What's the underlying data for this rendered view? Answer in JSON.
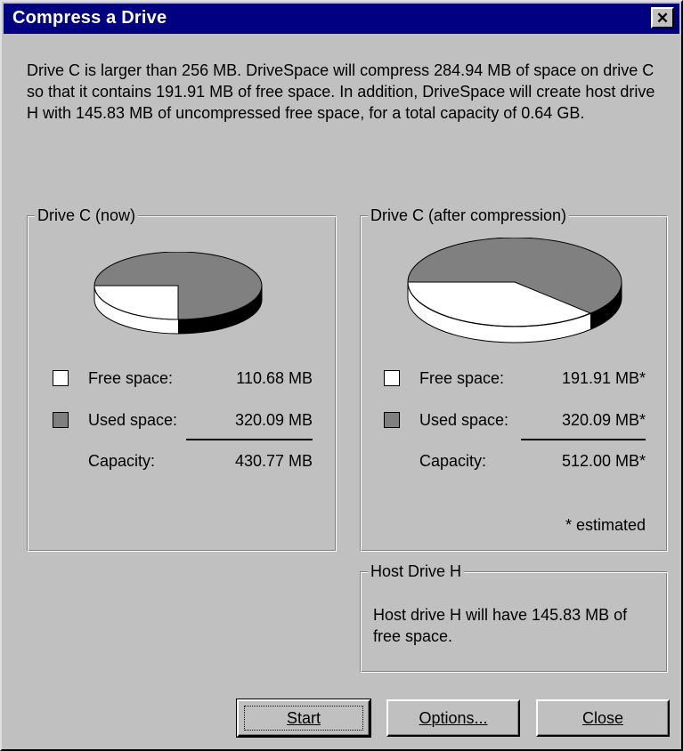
{
  "window": {
    "title": "Compress a Drive",
    "close_glyph": "✕"
  },
  "intro": "Drive C is larger than 256 MB. DriveSpace will compress 284.94 MB of space on drive C so that it contains 191.91 MB of free space. In addition, DriveSpace will create host drive H with 145.83 MB of uncompressed free space, for a total capacity of 0.64 GB.",
  "now": {
    "title": "Drive C (now)",
    "free_label": "Free space:",
    "free_value": "110.68 MB",
    "used_label": "Used space:",
    "used_value": "320.09 MB",
    "capacity_label": "Capacity:",
    "capacity_value": "430.77 MB",
    "free_fraction": 0.257
  },
  "after": {
    "title": "Drive C (after compression)",
    "free_label": "Free space:",
    "free_value": "191.91 MB*",
    "used_label": "Used space:",
    "used_value": "320.09 MB*",
    "capacity_label": "Capacity:",
    "capacity_value": "512.00 MB*",
    "note": "* estimated",
    "free_fraction": 0.375
  },
  "host": {
    "title": "Host Drive H",
    "text": "Host drive H will have 145.83 MB of free space."
  },
  "buttons": {
    "start": "Start",
    "options": "Options...",
    "close": "Close"
  },
  "colors": {
    "free": "#ffffff",
    "used": "#808080",
    "title_bar": "#000080",
    "face": "#c0c0c0"
  }
}
